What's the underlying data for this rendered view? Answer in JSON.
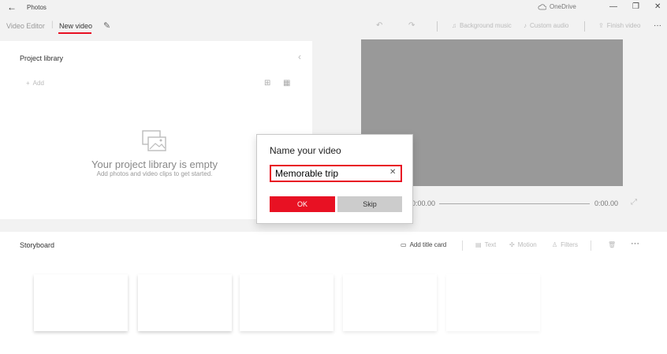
{
  "titlebar": {
    "app_title": "Photos",
    "onedrive_label": "OneDrive",
    "back_glyph": "←",
    "minimize_glyph": "—",
    "restore_glyph": "❐",
    "close_glyph": "✕"
  },
  "commandbar": {
    "crumbs": [
      "Video Editor",
      "New video"
    ],
    "background_music": "Background music",
    "custom_audio": "Custom audio",
    "finish_video": "Finish video",
    "more_glyph": "···"
  },
  "library": {
    "title": "Project library",
    "add_label": "Add",
    "empty_title": "Your project library is empty",
    "empty_subtitle": "Add photos and video clips to get started."
  },
  "preview": {
    "time_start": "0:00.00",
    "time_end": "0:00.00"
  },
  "storyboard": {
    "title": "Storyboard",
    "add_title_card": "Add title card",
    "text": "Text",
    "motion": "Motion",
    "filters": "Filters",
    "more_glyph": "···"
  },
  "dialog": {
    "title": "Name your video",
    "input_value": "Memorable trip",
    "ok_label": "OK",
    "skip_label": "Skip"
  },
  "colors": {
    "accent": "#e81123",
    "preview_bg": "#999999"
  }
}
